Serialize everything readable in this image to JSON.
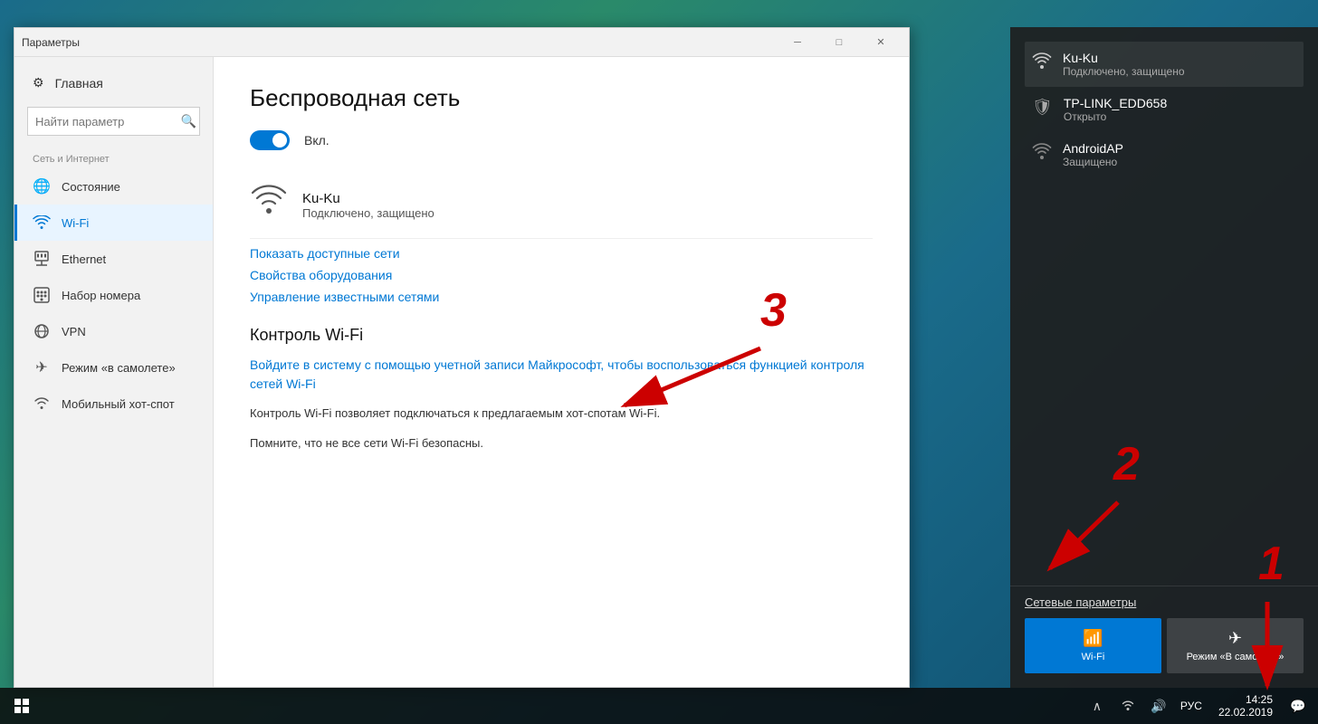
{
  "window": {
    "title": "Параметры",
    "minimize_label": "─",
    "maximize_label": "□",
    "close_label": "✕"
  },
  "sidebar": {
    "home_label": "Главная",
    "search_placeholder": "Найти параметр",
    "section_label": "Сеть и Интернет",
    "items": [
      {
        "id": "status",
        "label": "Состояние",
        "icon": "🌐"
      },
      {
        "id": "wifi",
        "label": "Wi-Fi",
        "icon": "📶",
        "active": true
      },
      {
        "id": "ethernet",
        "label": "Ethernet",
        "icon": "🖥"
      },
      {
        "id": "dialup",
        "label": "Набор номера",
        "icon": "📞"
      },
      {
        "id": "vpn",
        "label": "VPN",
        "icon": "🔗"
      },
      {
        "id": "airplane",
        "label": "Режим «в самолете»",
        "icon": "✈"
      },
      {
        "id": "hotspot",
        "label": "Мобильный хот-спот",
        "icon": "📡"
      }
    ]
  },
  "main": {
    "title": "Беспроводная сеть",
    "toggle_label": "Вкл.",
    "current_network": {
      "name": "Ku-Ku",
      "status": "Подключено, защищено"
    },
    "links": {
      "show_networks": "Показать доступные сети",
      "adapter_properties": "Свойства оборудования",
      "manage_networks": "Управление известными сетями"
    },
    "wifi_sense_title": "Контроль Wi-Fi",
    "wifi_sense_link": "Войдите в систему с помощью учетной записи Майкрософт, чтобы воспользоваться функцией контроля сетей Wi-Fi",
    "wifi_sense_desc1": "Контроль Wi-Fi позволяет подключаться к предлагаемым хот-спотам Wi-Fi.",
    "wifi_sense_desc2": "Помните, что не все сети Wi-Fi безопасны."
  },
  "flyout": {
    "networks": [
      {
        "name": "Ku-Ku",
        "status": "Подключено, защищено",
        "connected": true,
        "icon": "wifi"
      },
      {
        "name": "TP-LINK_EDD658",
        "status": "Открыто",
        "connected": false,
        "icon": "shield"
      },
      {
        "name": "AndroidAP",
        "status": "Защищено",
        "connected": false,
        "icon": "wifi"
      }
    ],
    "settings_link": "Сетевые параметры",
    "action_tiles": [
      {
        "id": "wifi",
        "label": "Wi-Fi",
        "icon": "📶",
        "active": true
      },
      {
        "id": "airplane",
        "label": "Режим «В самолете»",
        "icon": "✈",
        "active": false
      }
    ]
  },
  "taskbar": {
    "time": "14:25",
    "date": "22.02.2019",
    "language": "РУС"
  },
  "annotations": {
    "num1": "1",
    "num2": "2",
    "num3": "3"
  }
}
